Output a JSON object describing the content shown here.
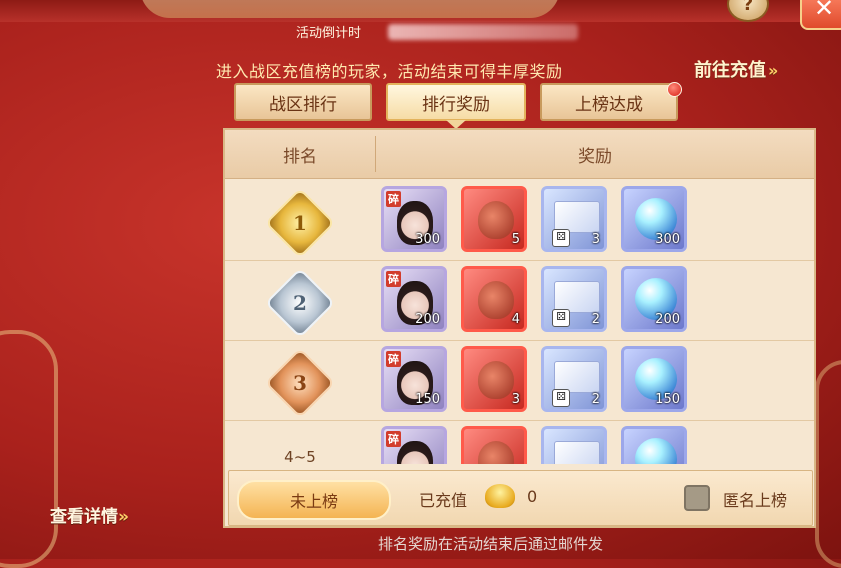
{
  "header": {
    "countdown_label": "活动倒计时",
    "intro_text": "进入战区充值榜的玩家，活动结束可得丰厚奖励",
    "goto_recharge": "前往充值",
    "help_glyph": "?",
    "close_glyph": "✕"
  },
  "tabs": [
    {
      "label": "战区排行",
      "active": false
    },
    {
      "label": "排行奖励",
      "active": true
    },
    {
      "label": "上榜达成",
      "active": false,
      "badge": true
    }
  ],
  "table": {
    "col_rank": "排名",
    "col_reward": "奖励",
    "rows": [
      {
        "rank_medal": "1",
        "medal": "gold",
        "rewards": [
          {
            "type": "hero-fragment-icon",
            "tag": "碎",
            "qty": "300"
          },
          {
            "type": "red-pouch-icon",
            "qty": "5"
          },
          {
            "type": "gift-box-icon",
            "qty": "3"
          },
          {
            "type": "crystal-orb-icon",
            "qty": "300"
          }
        ]
      },
      {
        "rank_medal": "2",
        "medal": "silver",
        "rewards": [
          {
            "type": "hero-fragment-icon",
            "tag": "碎",
            "qty": "200"
          },
          {
            "type": "red-pouch-icon",
            "qty": "4"
          },
          {
            "type": "gift-box-icon",
            "qty": "2"
          },
          {
            "type": "crystal-orb-icon",
            "qty": "200"
          }
        ]
      },
      {
        "rank_medal": "3",
        "medal": "bronze",
        "rewards": [
          {
            "type": "hero-fragment-icon",
            "tag": "碎",
            "qty": "150"
          },
          {
            "type": "red-pouch-icon",
            "qty": "3"
          },
          {
            "type": "gift-box-icon",
            "qty": "2"
          },
          {
            "type": "crystal-orb-icon",
            "qty": "150"
          }
        ]
      },
      {
        "rank_text": "4~5",
        "rewards": [
          {
            "type": "hero-fragment-icon",
            "tag": "碎"
          },
          {
            "type": "red-pouch-icon"
          },
          {
            "type": "gift-box-icon"
          },
          {
            "type": "crystal-orb-icon"
          }
        ]
      }
    ]
  },
  "status": {
    "not_ranked": "未上榜",
    "recharged_label": "已充值",
    "recharged_value": "0",
    "anonymous_label": "匿名上榜"
  },
  "footer": {
    "view_details": "查看详情",
    "note": "排名奖励在活动结束后通过邮件发"
  },
  "colors": {
    "background": "#b8281f",
    "accent_gold": "#ffe9b0",
    "panel": "#f6e7d1"
  }
}
